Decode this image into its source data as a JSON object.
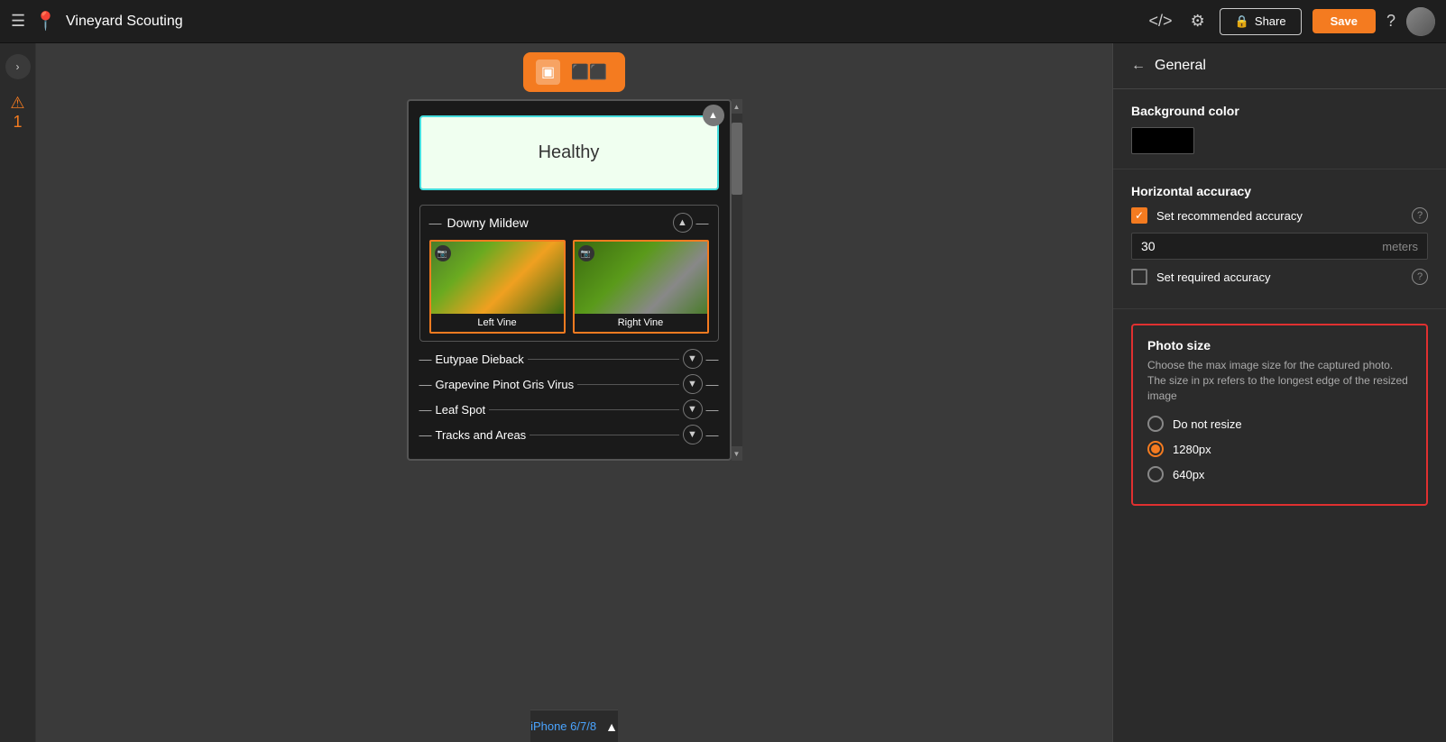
{
  "app": {
    "title": "Vineyard Scouting",
    "share_label": "Share",
    "save_label": "Save"
  },
  "topnav": {
    "code_icon": "</>",
    "settings_icon": "⚙",
    "help_icon": "?",
    "lock_icon": "🔒"
  },
  "canvas": {
    "view_single": "▣",
    "view_double": "⬜",
    "device_name": "iPhone 6/7/8"
  },
  "phone": {
    "healthy_label": "Healthy",
    "downy_mildew": {
      "title": "Downy Mildew",
      "photo1_label": "Left Vine",
      "photo2_label": "Right Vine"
    },
    "sections": [
      {
        "title": "Eutypae Dieback"
      },
      {
        "title": "Grapevine Pinot Gris Virus"
      },
      {
        "title": "Leaf Spot"
      },
      {
        "title": "Tracks and Areas"
      }
    ]
  },
  "right_panel": {
    "back_label": "General",
    "bg_color_label": "Background color",
    "bg_color_value": "#000000",
    "horiz_accuracy_label": "Horizontal accuracy",
    "set_recommended_label": "Set recommended accuracy",
    "recommended_value": "30",
    "recommended_unit": "meters",
    "set_required_label": "Set required accuracy",
    "photo_size_label": "Photo size",
    "photo_size_desc": "Choose the max image size for the captured photo. The size in px refers to the longest edge of the resized image",
    "radio_options": [
      {
        "label": "Do not resize",
        "selected": false
      },
      {
        "label": "1280px",
        "selected": true
      },
      {
        "label": "640px",
        "selected": false
      }
    ]
  },
  "warnings": {
    "count": "1",
    "icon": "⚠"
  }
}
